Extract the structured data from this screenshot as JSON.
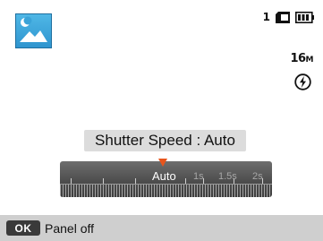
{
  "status": {
    "shots_remaining": "1",
    "memory_card_icon": "memory-card-icon",
    "battery_icon": "battery-full-icon",
    "resolution": "16",
    "resolution_unit": "M",
    "flash_icon": "flash-auto-icon"
  },
  "scene_mode": {
    "icon": "night-landscape-icon"
  },
  "shutter": {
    "label": "Shutter Speed : Auto",
    "scale_labels": [
      "Auto",
      "1s",
      "1.5s",
      "2s"
    ],
    "selected": "Auto"
  },
  "footer": {
    "ok_key": "OK",
    "action": "Panel off"
  },
  "colors": {
    "pointer": "#e8551c",
    "mode_icon_bg": "#2f95cf"
  }
}
